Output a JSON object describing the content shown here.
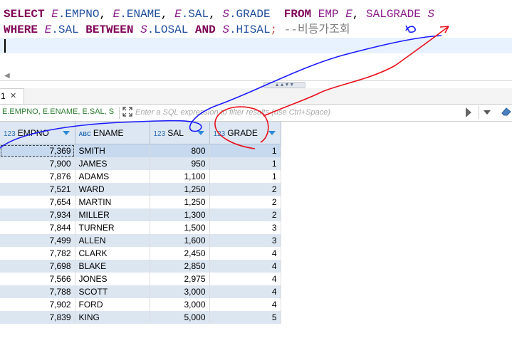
{
  "editor": {
    "line1": {
      "select": "SELECT",
      "a1": "E",
      "f1": ".EMPNO",
      "c1": ",",
      "a2": "E",
      "f2": ".ENAME",
      "c2": ",",
      "a3": "E",
      "f3": ".SAL",
      "c3": ",",
      "a4": "S",
      "f4": ".GRADE",
      "from": "FROM",
      "t1": "EMP",
      "a5": "E",
      "c4": ",",
      "t2": "SALGRADE",
      "a6": "S"
    },
    "line2": {
      "where": "WHERE",
      "a1": "E",
      "f1": ".SAL",
      "between": "BETWEEN",
      "a2": "S",
      "f2": ".LOSAL",
      "and": "AND",
      "a3": "S",
      "f3": ".HISAL",
      "semi": ";",
      "comment": "--비등가조회"
    }
  },
  "results_tab": {
    "label": "1",
    "close": "✕"
  },
  "filter": {
    "history": "E.EMPNO, E.ENAME, E.SAL, S",
    "placeholder": "Enter a SQL expression to filter results (use Ctrl+Space)"
  },
  "grid": {
    "columns": [
      {
        "type": "123",
        "name": "EMPNO"
      },
      {
        "type": "ABC",
        "name": "ENAME"
      },
      {
        "type": "123",
        "name": "SAL"
      },
      {
        "type": "123",
        "name": "GRADE"
      }
    ],
    "rows": [
      [
        "7,369",
        "SMITH",
        "800",
        "1"
      ],
      [
        "7,900",
        "JAMES",
        "950",
        "1"
      ],
      [
        "7,876",
        "ADAMS",
        "1,100",
        "1"
      ],
      [
        "7,521",
        "WARD",
        "1,250",
        "2"
      ],
      [
        "7,654",
        "MARTIN",
        "1,250",
        "2"
      ],
      [
        "7,934",
        "MILLER",
        "1,300",
        "2"
      ],
      [
        "7,844",
        "TURNER",
        "1,500",
        "3"
      ],
      [
        "7,499",
        "ALLEN",
        "1,600",
        "3"
      ],
      [
        "7,782",
        "CLARK",
        "2,450",
        "4"
      ],
      [
        "7,698",
        "BLAKE",
        "2,850",
        "4"
      ],
      [
        "7,566",
        "JONES",
        "2,975",
        "4"
      ],
      [
        "7,788",
        "SCOTT",
        "3,000",
        "4"
      ],
      [
        "7,902",
        "FORD",
        "3,000",
        "4"
      ],
      [
        "7,839",
        "KING",
        "5,000",
        "5"
      ]
    ]
  },
  "colors": {
    "keyword": "#7f0055",
    "alias": "#8b1b8b",
    "annotation_blue": "#1a1aff",
    "annotation_red": "#e8101a"
  }
}
